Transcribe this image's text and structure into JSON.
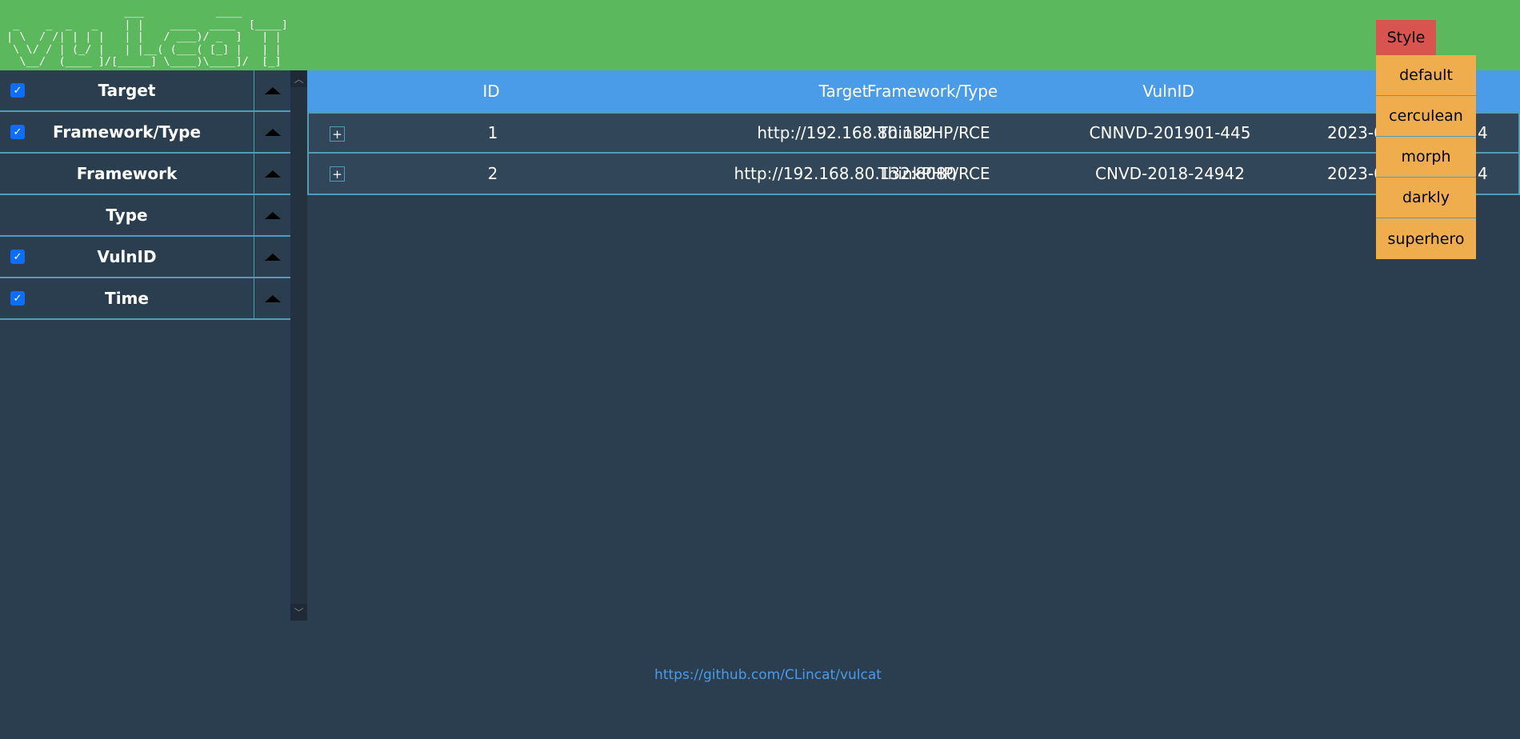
{
  "header": {
    "logo_text": "                  ___           ____\n _    _  _   _    | |    ____  ____  [____]\n| \\  / /| | | |   | |   / ___)/ _  ]   | |\n \\ \\/ / | (_/ |   | |__( (___( [_] |   | |\n  \\__/  (____ ]/[_____] \\____)\\____]/  [_]",
    "style_button": "Style",
    "style_options": [
      "default",
      "cerculean",
      "morph",
      "darkly",
      "superhero"
    ]
  },
  "sidebar": {
    "items": [
      {
        "label": "Target",
        "checked": true
      },
      {
        "label": "Framework/Type",
        "checked": true
      },
      {
        "label": "Framework",
        "checked": false
      },
      {
        "label": "Type",
        "checked": false
      },
      {
        "label": "VulnID",
        "checked": true
      },
      {
        "label": "Time",
        "checked": true
      }
    ]
  },
  "table": {
    "columns": [
      "ID",
      "Target",
      "Framework/Type",
      "VulnID"
    ],
    "rows": [
      {
        "id": "1",
        "target": "http://192.168.80.132",
        "framework_type": "ThinkPHP/RCE",
        "vulnid": "CNNVD-201901-445",
        "time_start": "2023-0",
        "time_end": "4"
      },
      {
        "id": "2",
        "target": "http://192.168.80.132:8080",
        "framework_type": "ThinkPHP/RCE",
        "vulnid": "CNVD-2018-24942",
        "time_start": "2023-0",
        "time_end": "4"
      }
    ]
  },
  "footer": {
    "link": "https://github.com/CLincat/vulcat"
  },
  "colors": {
    "header": "#5cb85c",
    "table_header": "#4a9be8",
    "style_button": "#d9534f",
    "style_menu": "#f0ad4e",
    "background": "#2b3e50"
  }
}
